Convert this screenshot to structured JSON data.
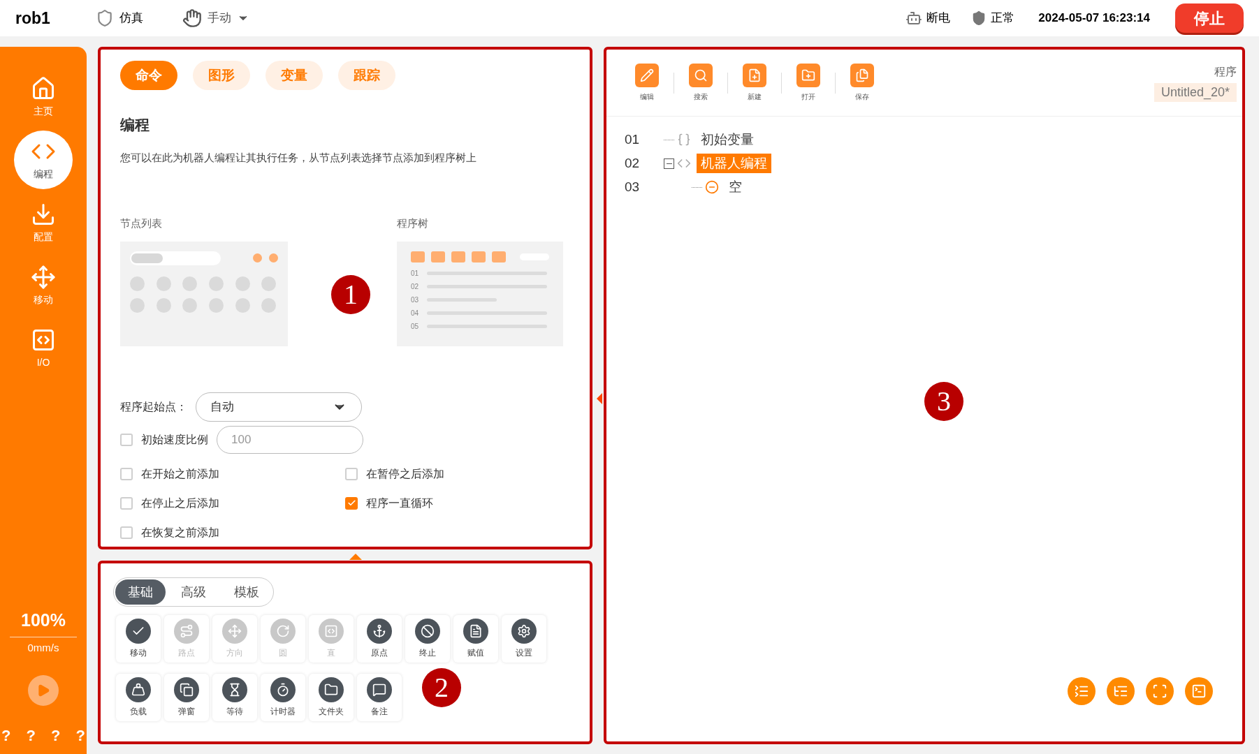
{
  "top_bar": {
    "robot": "rob1",
    "mode": "仿真",
    "control": "手动",
    "power": "断电",
    "safety": "正常",
    "datetime": "2024-05-07 16:23:14",
    "stop_button": "停止"
  },
  "sidebar": {
    "items": [
      {
        "label": "主页",
        "kind": "home",
        "selected": false
      },
      {
        "label": "编程",
        "kind": "code",
        "selected": true
      },
      {
        "label": "配置",
        "kind": "config",
        "selected": false
      },
      {
        "label": "移动",
        "kind": "move",
        "selected": false
      },
      {
        "label": "I/O",
        "kind": "io",
        "selected": false
      }
    ],
    "speed": "100%",
    "velocity": "0mm/s",
    "help": [
      "?",
      "?",
      "?",
      "?"
    ]
  },
  "command_panel": {
    "tabs": [
      {
        "label": "命令",
        "selected": true
      },
      {
        "label": "图形",
        "selected": false
      },
      {
        "label": "变量",
        "selected": false
      },
      {
        "label": "跟踪",
        "selected": false
      }
    ],
    "title": "编程",
    "description": "您可以在此为机器人编程让其执行任务，从节点列表选择节点添加到程序树上",
    "node_list_label": "节点列表",
    "program_tree_label": "程序树",
    "tree_line_numbers": [
      "01",
      "02",
      "03",
      "04",
      "05"
    ],
    "start_point": {
      "label": "程序起始点：",
      "value": "自动"
    },
    "speed_ratio": {
      "label": "初始速度比例",
      "checked": false,
      "placeholder": "100"
    },
    "options": [
      {
        "label": "在开始之前添加",
        "checked": false
      },
      {
        "label": "在暂停之后添加",
        "checked": false
      },
      {
        "label": "在停止之后添加",
        "checked": false
      },
      {
        "label": "程序一直循环",
        "checked": true
      },
      {
        "label": "在恢复之前添加",
        "checked": false
      }
    ]
  },
  "node_panel": {
    "tabs": [
      {
        "label": "基础",
        "selected": true
      },
      {
        "label": "高级",
        "selected": false
      },
      {
        "label": "模板",
        "selected": false
      }
    ],
    "nodes": [
      {
        "label": "移动",
        "kind": "move",
        "disabled": false
      },
      {
        "label": "路点",
        "kind": "waypoint",
        "disabled": true
      },
      {
        "label": "方向",
        "kind": "direction",
        "disabled": true
      },
      {
        "label": "圆",
        "kind": "circle",
        "disabled": true
      },
      {
        "label": "直",
        "kind": "line",
        "disabled": true
      },
      {
        "label": "原点",
        "kind": "origin",
        "disabled": false
      },
      {
        "label": "终止",
        "kind": "stop",
        "disabled": false
      },
      {
        "label": "赋值",
        "kind": "assign",
        "disabled": false
      },
      {
        "label": "设置",
        "kind": "settings",
        "disabled": false
      },
      {
        "label": "负载",
        "kind": "load",
        "disabled": false
      },
      {
        "label": "弹窗",
        "kind": "popup",
        "disabled": false
      },
      {
        "label": "等待",
        "kind": "wait",
        "disabled": false
      },
      {
        "label": "计时器",
        "kind": "timer",
        "disabled": false
      },
      {
        "label": "文件夹",
        "kind": "folder",
        "disabled": false
      },
      {
        "label": "备注",
        "kind": "note",
        "disabled": false
      }
    ]
  },
  "program_panel": {
    "toolbar": [
      {
        "label": "编辑",
        "kind": "edit"
      },
      {
        "label": "搜索",
        "kind": "search"
      },
      {
        "label": "新建",
        "kind": "new"
      },
      {
        "label": "打开",
        "kind": "open"
      },
      {
        "label": "保存",
        "kind": "save"
      }
    ],
    "program_label": "程序",
    "program_name": "Untitled_20*",
    "tree": [
      {
        "number": "01",
        "label": "初始变量",
        "kind": "variables",
        "selected": false
      },
      {
        "number": "02",
        "label": "机器人编程",
        "kind": "program",
        "selected": true,
        "expanded": true,
        "children": [
          {
            "number": "03",
            "label": "空",
            "kind": "empty",
            "selected": false
          }
        ]
      }
    ],
    "view_buttons": [
      {
        "kind": "collapse"
      },
      {
        "kind": "expand"
      },
      {
        "kind": "fit"
      },
      {
        "kind": "console"
      }
    ]
  },
  "callouts": [
    "1",
    "2",
    "3"
  ]
}
